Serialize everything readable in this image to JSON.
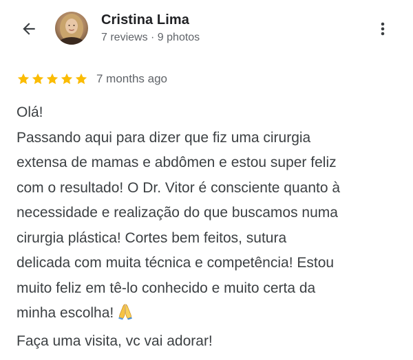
{
  "header": {
    "back_icon": "arrow-back-icon",
    "author_name": "Cristina Lima",
    "author_meta": "7 reviews · 9 photos",
    "more_icon": "more-vertical-icon"
  },
  "review": {
    "rating": 5,
    "rating_max": 5,
    "star_color": "#fbbc04",
    "time_ago": "7 months ago",
    "lines": [
      "Olá!",
      "Passando aqui para dizer que fiz uma cirurgia",
      "extensa de mamas e abdômen e estou super feliz",
      "com o resultado! O Dr. Vitor é consciente quanto à",
      "necessidade e realização do que buscamos numa",
      "cirurgia plástica! Cortes bem feitos, sutura",
      "delicada com muita técnica e competência! Estou",
      "muito feliz em tê-lo conhecido e muito certa da",
      "minha escolha!",
      "Faça uma visita, vc vai adorar!"
    ],
    "emoji_icon": "folded-hands-emoji"
  }
}
